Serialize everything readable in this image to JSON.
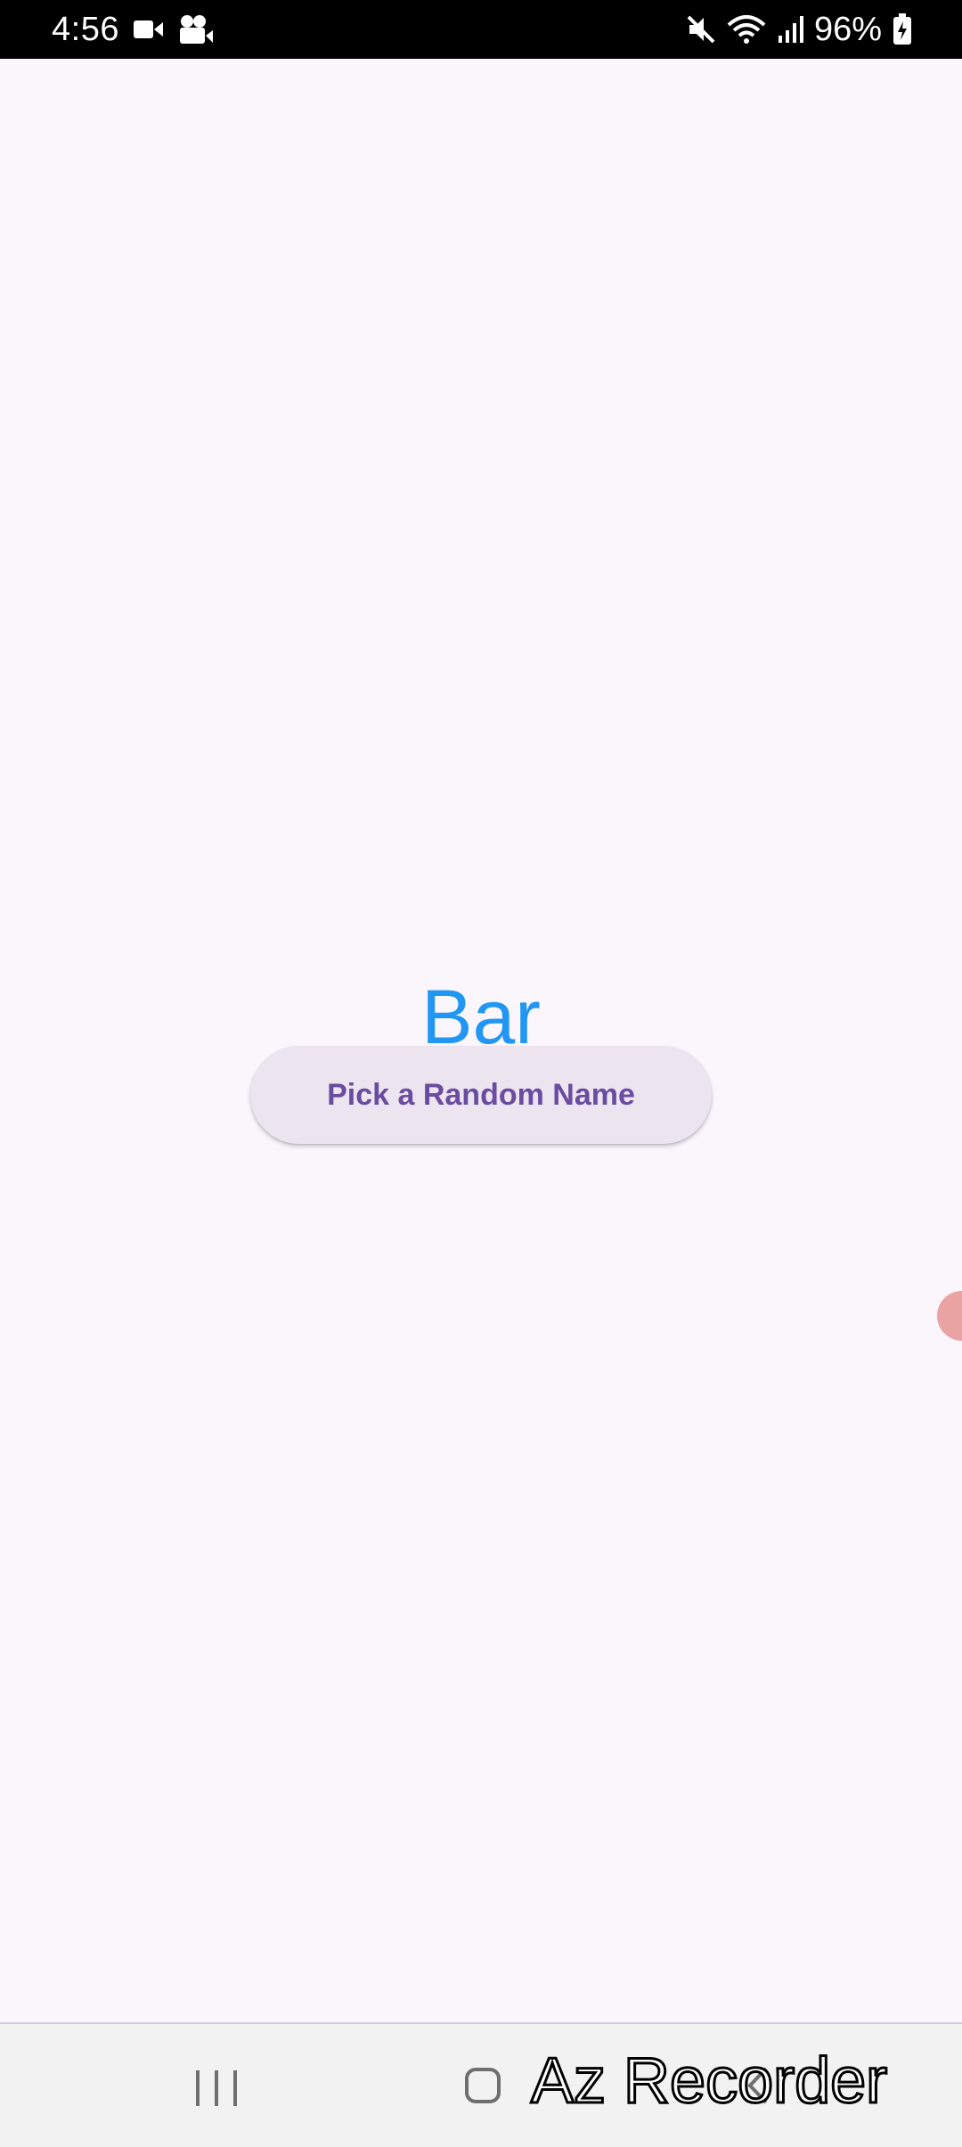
{
  "status_bar": {
    "time": "4:56",
    "battery": "96%",
    "icons": [
      "video-camera-icon",
      "camera-icon",
      "mute-icon",
      "wifi-icon",
      "signal-icon",
      "battery-charging-icon"
    ]
  },
  "main": {
    "picked_name": "Bar",
    "button_label": "Pick a Random Name"
  },
  "nav_bar": {
    "icons": [
      "recent-apps-icon",
      "home-icon",
      "back-icon"
    ]
  },
  "watermark": "Az Recorder",
  "colors": {
    "name_text": "#2196f3",
    "button_bg": "#ece5f0",
    "button_text": "#6a4ca0",
    "background": "#fbf6fc",
    "touch_indicator": "#e9a3a3"
  }
}
